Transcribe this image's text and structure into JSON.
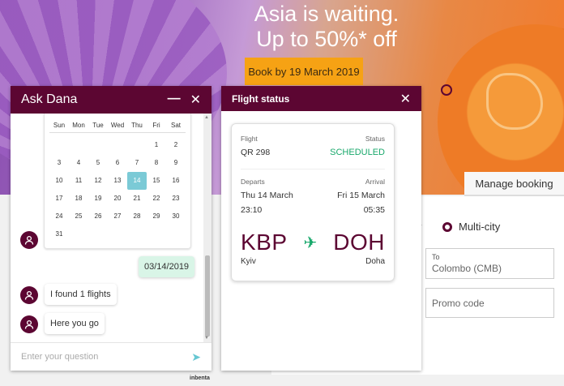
{
  "hero": {
    "headline_line1": "Asia is waiting.",
    "headline_line2": "Up to 50%* off",
    "cta_label": "Book by 19 March 2019"
  },
  "booking": {
    "manage_label": "Manage booking",
    "trip_type_fragment": "y",
    "multi_city_label": "Multi-city",
    "to_label": "To",
    "to_value": "Colombo (CMB)",
    "promo_placeholder": "Promo code"
  },
  "chat": {
    "title": "Ask Dana",
    "minimize_glyph": "—",
    "close_glyph": "✕",
    "calendar": {
      "weekdays": [
        "Sun",
        "Mon",
        "Tue",
        "Wed",
        "Thu",
        "Fri",
        "Sat"
      ],
      "days": [
        "",
        "",
        "",
        "",
        "",
        "1",
        "2",
        "3",
        "4",
        "5",
        "6",
        "7",
        "8",
        "9",
        "10",
        "11",
        "12",
        "13",
        "14",
        "15",
        "16",
        "17",
        "18",
        "19",
        "20",
        "21",
        "22",
        "23",
        "24",
        "25",
        "26",
        "27",
        "28",
        "29",
        "30",
        "31"
      ],
      "selected": "14"
    },
    "messages": {
      "user_date": "03/14/2019",
      "bot_found": "I found 1 flights",
      "bot_here": "Here you go"
    },
    "input_placeholder": "Enter your question",
    "brand": "inbenta"
  },
  "flight_status": {
    "title": "Flight status",
    "close_glyph": "✕",
    "flight_label": "Flight",
    "flight_value": "QR 298",
    "status_label": "Status",
    "status_value": "SCHEDULED",
    "departs_label": "Departs",
    "departs_date": "Thu 14 March",
    "departs_time": "23:10",
    "arrival_label": "Arrival",
    "arrival_date": "Fri 15 March",
    "arrival_time": "05:35",
    "origin_code": "KBP",
    "origin_city": "Kyiv",
    "dest_code": "DOH",
    "dest_city": "Doha"
  },
  "colors": {
    "brand": "#5c0632",
    "status_green": "#18a86b",
    "cta": "#f6a214",
    "selected_day": "#7bcad6"
  }
}
